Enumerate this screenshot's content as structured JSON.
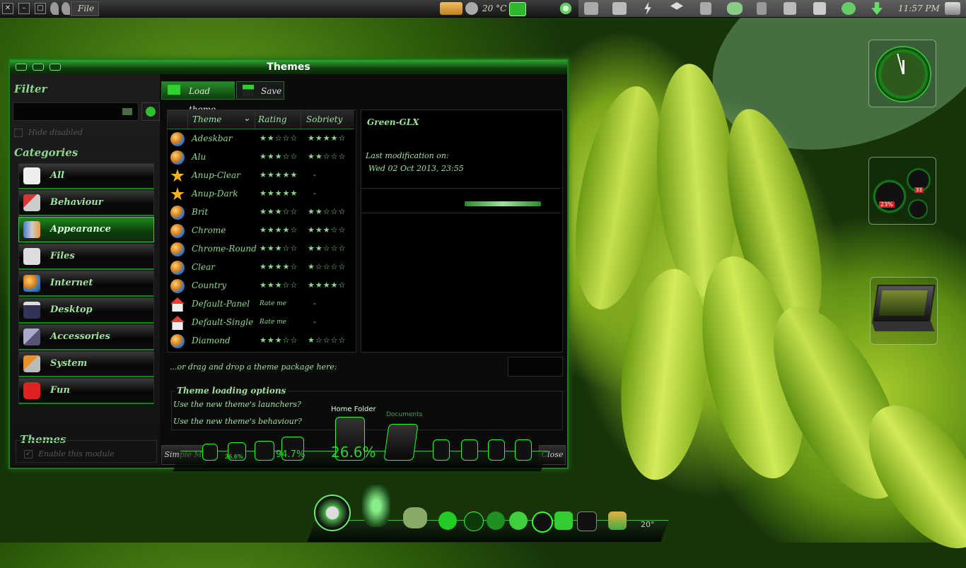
{
  "top_panel": {
    "menu_label": "File",
    "temperature": "20 °C",
    "clock": "11:57 PM"
  },
  "window": {
    "title": "Themes",
    "sidebar": {
      "filter_heading": "Filter",
      "hide_disabled_label": "Hide disabled",
      "categories_heading": "Categories",
      "categories": [
        "All",
        "Behaviour",
        "Appearance",
        "Files",
        "Internet",
        "Desktop",
        "Accessories",
        "System",
        "Fun"
      ],
      "selected_category": "Appearance",
      "module_heading": "Themes",
      "enable_module_label": "Enable this module"
    },
    "tabs": {
      "load": "Load theme",
      "save": "Save"
    },
    "list": {
      "col_theme": "Theme",
      "col_rating": "Rating",
      "col_sobriety": "Sobriety",
      "rows": [
        {
          "name": "Adeskbar",
          "rating": "★★☆☆☆",
          "sobriety": "★★★★☆",
          "icon": "globe-icon"
        },
        {
          "name": "Alu",
          "rating": "★★★☆☆",
          "sobriety": "★★☆☆☆",
          "icon": "globe-icon"
        },
        {
          "name": "Anup-Clear",
          "rating": "★★★★★",
          "sobriety": "-",
          "icon": "star-icon"
        },
        {
          "name": "Anup-Dark",
          "rating": "★★★★★",
          "sobriety": "-",
          "icon": "star-icon"
        },
        {
          "name": "Brit",
          "rating": "★★★☆☆",
          "sobriety": "★★☆☆☆",
          "icon": "globe-icon"
        },
        {
          "name": "Chrome",
          "rating": "★★★★☆",
          "sobriety": "★★★☆☆",
          "icon": "globe-icon"
        },
        {
          "name": "Chrome-Round",
          "rating": "★★★☆☆",
          "sobriety": "★★☆☆☆",
          "icon": "globe-icon"
        },
        {
          "name": "Clear",
          "rating": "★★★★☆",
          "sobriety": "★☆☆☆☆",
          "icon": "globe-icon"
        },
        {
          "name": "Country",
          "rating": "★★★☆☆",
          "sobriety": "★★★★☆",
          "icon": "globe-icon"
        },
        {
          "name": "Default-Panel",
          "rating": "Rate me",
          "sobriety": "-",
          "icon": "house-icon"
        },
        {
          "name": "Default-Single",
          "rating": "Rate me",
          "sobriety": "-",
          "icon": "house-icon"
        },
        {
          "name": "Diamond",
          "rating": "★★★☆☆",
          "sobriety": "★☆☆☆☆",
          "icon": "globe-icon"
        }
      ]
    },
    "detail": {
      "theme_name": "Green-GLX",
      "last_mod_label": "Last modification on:",
      "last_mod_value": "Wed 02 Oct 2013, 23:55"
    },
    "drop_text": "...or drag and drop a theme package here:",
    "options": {
      "heading": "Theme loading options",
      "opt1": "Use the new theme's launchers?",
      "opt2": "Use the new theme's behaviour?"
    },
    "buttons": {
      "simple": "Simple M",
      "close": "Close"
    }
  },
  "dock": {
    "home_folder_label": "Home Folder",
    "documents_label": "Documents",
    "percent_1": "94.7%",
    "percent_2": "26.6%",
    "percent_3": "26.6%",
    "gauge_temp": "20°"
  },
  "desklets": {
    "gauge_value": "23%",
    "gauge_small": "33"
  }
}
